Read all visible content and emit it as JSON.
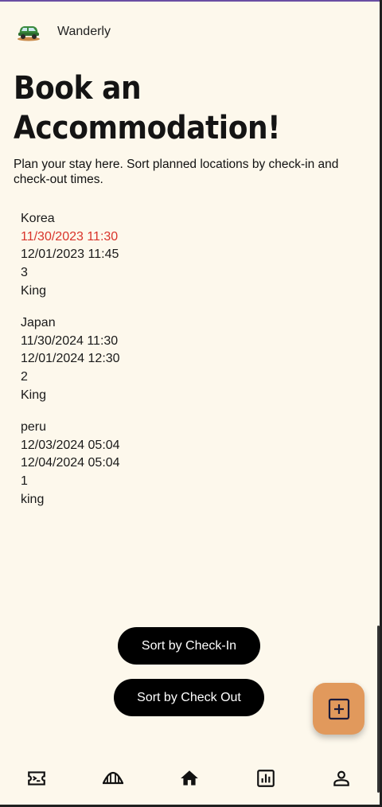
{
  "app": {
    "name": "Wanderly",
    "logo_icon": "car-icon"
  },
  "page": {
    "title": "Book an Accommodation!",
    "subtitle": "Plan your stay here. Sort planned locations by check-in and check-out times."
  },
  "accommodations": [
    {
      "location": "Korea",
      "check_in": "11/30/2023 11:30",
      "check_out": "12/01/2023 11:45",
      "guests": "3",
      "bed": "King",
      "check_in_color": "#d9342b"
    },
    {
      "location": "Japan",
      "check_in": "11/30/2024 11:30",
      "check_out": "12/01/2024 12:30",
      "guests": "2",
      "bed": "King"
    },
    {
      "location": "peru",
      "check_in": "12/03/2024 05:04",
      "check_out": "12/04/2024 05:04",
      "guests": "1",
      "bed": "king"
    }
  ],
  "buttons": {
    "sort_check_in": "Sort by Check-In",
    "sort_check_out": "Sort by Check Out"
  },
  "fab": {
    "icon": "add-box-icon",
    "color": "#e1995c"
  },
  "bottom_nav": [
    "ticket-icon",
    "bridge-icon",
    "home-icon",
    "analytics-icon",
    "person-icon"
  ],
  "colors": {
    "background": "#fdf8ec",
    "accent": "#e1995c",
    "alert": "#d9342b"
  }
}
